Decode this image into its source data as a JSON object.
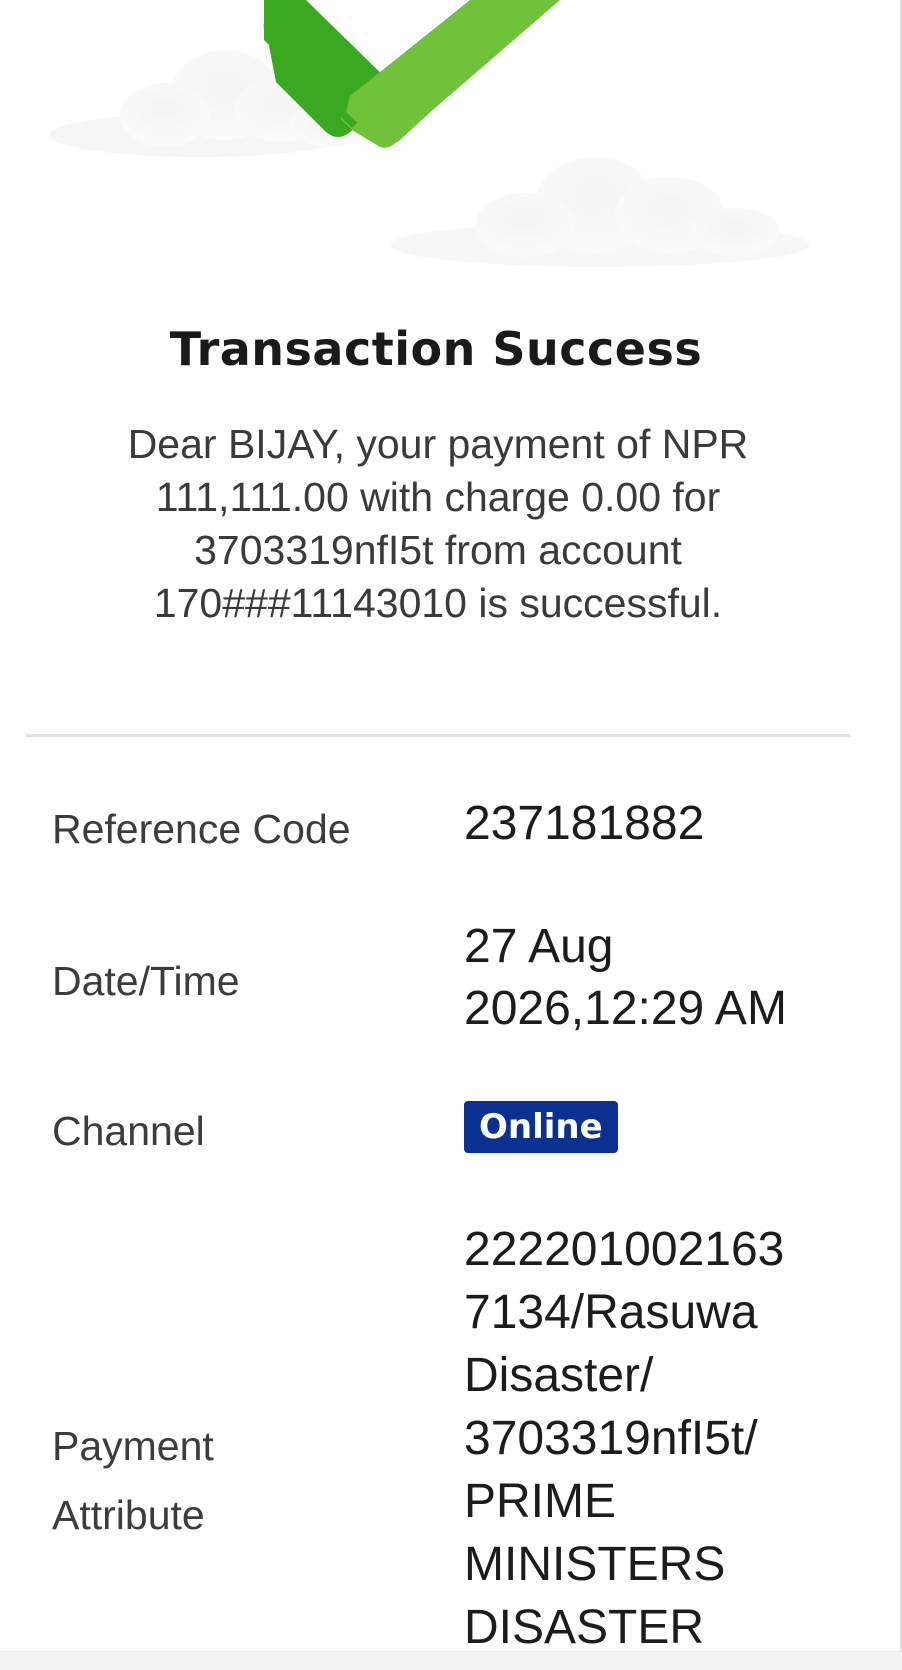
{
  "success": {
    "title": "Transaction Success",
    "message": "Dear BIJAY, your payment of NPR 111,111.00 with charge 0.00 for 3703319nfI5t from account 170###11143010 is successful."
  },
  "details": {
    "reference_code": {
      "label": "Reference Code",
      "value": "237181882"
    },
    "date_time": {
      "label": "Date/Time",
      "value_line1": "27 Aug",
      "value_line2": "2026,12:29 AM"
    },
    "channel": {
      "label": "Channel",
      "value": "Online"
    },
    "payment_attribute": {
      "label_line1": "Payment",
      "label_line2": "Attribute",
      "value_lines": [
        "222201002163",
        "7134/Rasuwa",
        "Disaster/",
        "3703319nfI5t/",
        "PRIME",
        "MINISTERS",
        "DISASTER"
      ]
    }
  },
  "icons": {
    "hero": "success-checkmark-icon",
    "decoration": "cloud-icon"
  },
  "colors": {
    "check_dark": "#3aa821",
    "check_light": "#6fc23a",
    "badge_bg": "#0a3192",
    "badge_text": "#ffffff",
    "divider": "#e2e2e2"
  }
}
